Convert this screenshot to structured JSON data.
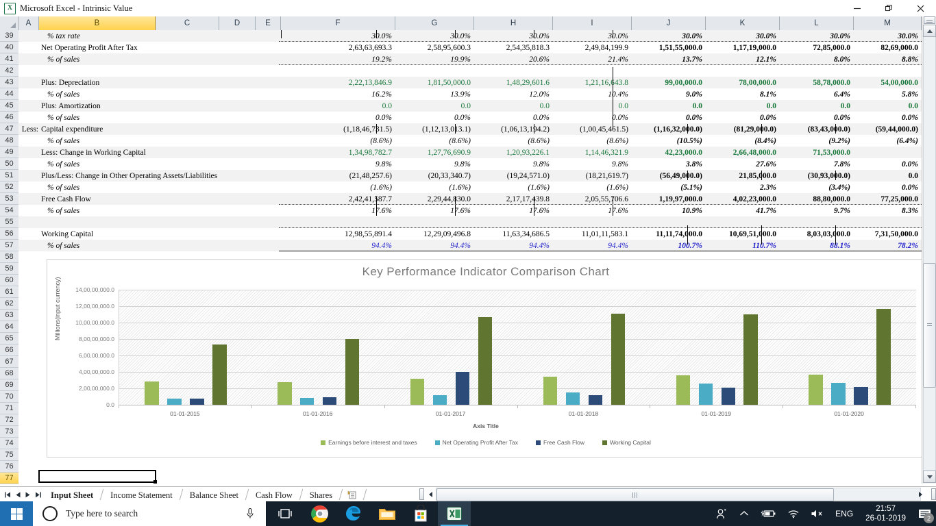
{
  "window": {
    "title": "Microsoft Excel - Intrinsic Value",
    "app_icon": "excel-icon",
    "minimize_label": "Minimize",
    "restore_label": "Restore",
    "close_label": "Close"
  },
  "grid": {
    "columns": [
      "A",
      "B",
      "C",
      "D",
      "E",
      "F",
      "G",
      "H",
      "I",
      "J",
      "K",
      "L",
      "M"
    ],
    "selected_column": "B",
    "selected_row": "77",
    "rows": [
      "39",
      "40",
      "41",
      "42",
      "43",
      "44",
      "45",
      "46",
      "47",
      "48",
      "49",
      "50",
      "51",
      "52",
      "53",
      "54",
      "55",
      "56",
      "57",
      "58",
      "59",
      "60",
      "61",
      "62",
      "63",
      "64",
      "65",
      "66",
      "67",
      "68",
      "69",
      "70",
      "71",
      "72",
      "73",
      "74",
      "75",
      "76",
      "77"
    ],
    "active_cell_ref": "B77"
  },
  "table": {
    "line_items": [
      {
        "row": "39",
        "prefix": "",
        "label": "% tax rate",
        "style": "italic",
        "values": [
          "30.0%",
          "30.0%",
          "30.0%",
          "30.0%",
          "30.0%",
          "30.0%",
          "30.0%",
          "30.0%"
        ],
        "bold_right": true,
        "color": "black"
      },
      {
        "row": "40",
        "prefix": "",
        "label": "Net Operating Profit After Tax",
        "style": "normal",
        "values": [
          "2,63,63,693.3",
          "2,58,95,600.3",
          "2,54,35,818.3",
          "2,49,84,199.9",
          "1,51,55,000.0",
          "1,17,19,000.0",
          "72,85,000.0",
          "82,69,000.0"
        ],
        "bold_right": true,
        "color": "black"
      },
      {
        "row": "41",
        "prefix": "",
        "label": "% of sales",
        "style": "italic",
        "values": [
          "19.2%",
          "19.9%",
          "20.6%",
          "21.4%",
          "13.7%",
          "12.1%",
          "8.0%",
          "8.8%"
        ],
        "bold_right": true,
        "color": "black"
      },
      {
        "row": "42",
        "prefix": "",
        "label": "",
        "style": "normal",
        "values": [
          "",
          "",
          "",
          "",
          "",
          "",
          "",
          ""
        ],
        "bold_right": false,
        "color": "black"
      },
      {
        "row": "43",
        "prefix": "",
        "label": "Plus: Depreciation",
        "style": "normal",
        "values": [
          "2,22,13,846.9",
          "1,81,50,000.0",
          "1,48,29,601.6",
          "1,21,16,643.8",
          "99,00,000.0",
          "78,00,000.0",
          "58,78,000.0",
          "54,00,000.0"
        ],
        "bold_right": true,
        "color": "green"
      },
      {
        "row": "44",
        "prefix": "",
        "label": "% of sales",
        "style": "italic",
        "values": [
          "16.2%",
          "13.9%",
          "12.0%",
          "10.4%",
          "9.0%",
          "8.1%",
          "6.4%",
          "5.8%"
        ],
        "bold_right": true,
        "color": "black"
      },
      {
        "row": "45",
        "prefix": "",
        "label": "Plus: Amortization",
        "style": "normal",
        "values": [
          "0.0",
          "0.0",
          "0.0",
          "0.0",
          "0.0",
          "0.0",
          "0.0",
          "0.0"
        ],
        "bold_right": true,
        "color": "green"
      },
      {
        "row": "46",
        "prefix": "",
        "label": "% of sales",
        "style": "italic",
        "values": [
          "0.0%",
          "0.0%",
          "0.0%",
          "0.0%",
          "0.0%",
          "0.0%",
          "0.0%",
          "0.0%"
        ],
        "bold_right": true,
        "color": "black"
      },
      {
        "row": "47",
        "prefix": "Less:",
        "label": "Capital expenditure",
        "style": "normal",
        "values": [
          "(1,18,46,731.5)",
          "(1,12,13,013.1)",
          "(1,06,13,194.2)",
          "(1,00,45,461.5)",
          "(1,16,32,000.0)",
          "(81,29,000.0)",
          "(83,43,000.0)",
          "(59,44,000.0)"
        ],
        "bold_right": true,
        "color": "black"
      },
      {
        "row": "48",
        "prefix": "",
        "label": "% of sales",
        "style": "italic",
        "values": [
          "(8.6%)",
          "(8.6%)",
          "(8.6%)",
          "(8.6%)",
          "(10.5%)",
          "(8.4%)",
          "(9.2%)",
          "(6.4%)"
        ],
        "bold_right": true,
        "color": "black"
      },
      {
        "row": "49",
        "prefix": "",
        "label": "Less: Change in Working Capital",
        "style": "normal",
        "values": [
          "1,34,98,782.7",
          "1,27,76,690.9",
          "1,20,93,226.1",
          "1,14,46,321.9",
          "42,23,000.0",
          "2,66,48,000.0",
          "71,53,000.0",
          ""
        ],
        "bold_right": true,
        "color": "green"
      },
      {
        "row": "50",
        "prefix": "",
        "label": "% of sales",
        "style": "italic",
        "values": [
          "9.8%",
          "9.8%",
          "9.8%",
          "9.8%",
          "3.8%",
          "27.6%",
          "7.8%",
          "0.0%"
        ],
        "bold_right": true,
        "color": "black"
      },
      {
        "row": "51",
        "prefix": "",
        "label": "Plus/Less: Change in Other Operating Assets/Liabilities",
        "style": "normal",
        "values": [
          "(21,48,257.6)",
          "(20,33,340.7)",
          "(19,24,571.0)",
          "(18,21,619.7)",
          "(56,49,000.0)",
          "21,85,000.0",
          "(30,93,000.0)",
          "0.0"
        ],
        "bold_right": true,
        "color": "black"
      },
      {
        "row": "52",
        "prefix": "",
        "label": "% of sales",
        "style": "italic",
        "values": [
          "(1.6%)",
          "(1.6%)",
          "(1.6%)",
          "(1.6%)",
          "(5.1%)",
          "2.3%",
          "(3.4%)",
          "0.0%"
        ],
        "bold_right": true,
        "color": "black"
      },
      {
        "row": "53",
        "prefix": "",
        "label": "Free Cash Flow",
        "style": "normal",
        "values": [
          "2,42,41,587.7",
          "2,29,44,830.0",
          "2,17,17,439.8",
          "2,05,55,706.6",
          "1,19,97,000.0",
          "4,02,23,000.0",
          "88,80,000.0",
          "77,25,000.0"
        ],
        "bold_right": true,
        "color": "black"
      },
      {
        "row": "54",
        "prefix": "",
        "label": "% of sales",
        "style": "italic",
        "values": [
          "17.6%",
          "17.6%",
          "17.6%",
          "17.6%",
          "10.9%",
          "41.7%",
          "9.7%",
          "8.3%"
        ],
        "bold_right": true,
        "color": "black"
      },
      {
        "row": "55",
        "prefix": "",
        "label": "",
        "style": "normal",
        "values": [
          "",
          "",
          "",
          "",
          "",
          "",
          "",
          ""
        ],
        "bold_right": false,
        "color": "black"
      },
      {
        "row": "56",
        "prefix": "",
        "label": "Working Capital",
        "style": "normal",
        "values": [
          "12,98,55,891.4",
          "12,29,09,496.8",
          "11,63,34,686.5",
          "11,01,11,583.1",
          "11,11,74,000.0",
          "10,69,51,000.0",
          "8,03,03,000.0",
          "7,31,50,000.0"
        ],
        "bold_right": true,
        "color": "black"
      },
      {
        "row": "57",
        "prefix": "",
        "label": "% of sales",
        "style": "italic",
        "values": [
          "94.4%",
          "94.4%",
          "94.4%",
          "94.4%",
          "100.7%",
          "110.7%",
          "88.1%",
          "78.2%"
        ],
        "bold_right": true,
        "color": "blue"
      }
    ]
  },
  "chart_data": {
    "type": "bar",
    "title": "Key Performance  Indicator Comparison  Chart",
    "xlabel": "Axis Title",
    "ylabel": "Millions(input currency)",
    "categories": [
      "01-01-2015",
      "01-01-2016",
      "01-01-2017",
      "01-01-2018",
      "01-01-2019",
      "01-01-2020"
    ],
    "ytick_labels": [
      "0.0",
      "2,00,00,000.0",
      "4,00,00,000.0",
      "6,00,00,000.0",
      "8,00,00,000.0",
      "10,00,00,000.0",
      "12,00,00,000.0",
      "14,00,00,000.0"
    ],
    "ylim": [
      0,
      140000000
    ],
    "grid": true,
    "legend_position": "bottom",
    "series": [
      {
        "name": "Earnings before interest and taxes",
        "color": "#9BBB59",
        "values": [
          28500000,
          27500000,
          31500000,
          34000000,
          35500000,
          36500000
        ]
      },
      {
        "name": "Net Operating Profit After Tax",
        "color": "#4BACC6",
        "values": [
          7285000,
          8269000,
          11719000,
          15155000,
          25835000,
          26363000
        ]
      },
      {
        "name": "Free Cash Flow",
        "color": "#2C4B79",
        "values": [
          7725000,
          8880000,
          40223000,
          11997000,
          20555000,
          21717000
        ]
      },
      {
        "name": "Working Capital",
        "color": "#5F7530",
        "values": [
          73150000,
          80303000,
          106951000,
          111174000,
          110111583,
          116334686
        ]
      }
    ]
  },
  "sheet_tabs": {
    "items": [
      "Input Sheet",
      "Income Statement",
      "Balance Sheet",
      "Cash Flow",
      "Shares"
    ],
    "active": "Input Sheet",
    "new_sheet_label": "Insert Worksheet"
  },
  "taskbar": {
    "search_placeholder": "Type here to search",
    "language": "ENG",
    "time": "21:57",
    "date": "26-01-2019",
    "notification_count": "2",
    "icons": [
      "task-view-icon",
      "chrome-icon",
      "edge-icon",
      "file-explorer-icon",
      "microsoft-store-icon",
      "excel-icon"
    ]
  }
}
